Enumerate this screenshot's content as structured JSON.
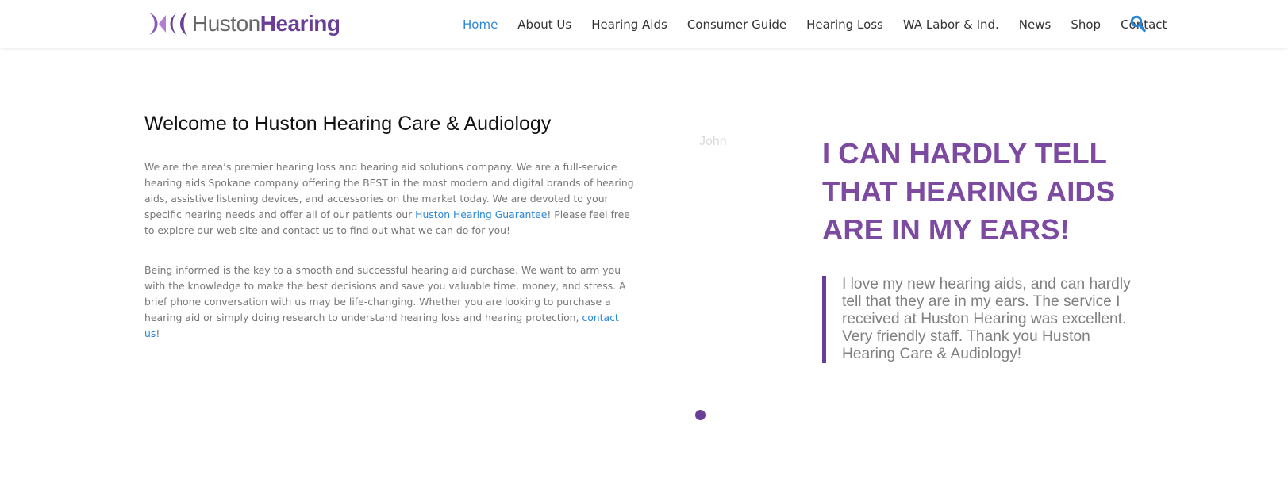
{
  "site": {
    "logo_light": "Huston",
    "logo_bold": "Hearing",
    "brand_color": "#6a3d96",
    "accent_color": "#2a87d8"
  },
  "nav": {
    "items": [
      {
        "label": "Home",
        "active": true
      },
      {
        "label": "About Us"
      },
      {
        "label": "Hearing Aids"
      },
      {
        "label": "Consumer Guide"
      },
      {
        "label": "Hearing Loss"
      },
      {
        "label": "WA Labor & Ind."
      },
      {
        "label": "News"
      },
      {
        "label": "Shop"
      },
      {
        "label": "Contact"
      }
    ],
    "search_icon": "search-icon"
  },
  "main": {
    "title": "Welcome to Huston Hearing Care & Audiology",
    "para1_before": "We are the area’s premier hearing loss and hearing aid solutions company.  We are a full-service hearing aids Spokane company offering the BEST in the most modern and digital brands of hearing aids, assistive listening devices, and accessories on the market today. We are devoted to your specific hearing needs and offer all of our patients our ",
    "para1_link": "Huston Hearing Guarantee",
    "para1_after": "! Please feel free to explore our web site and contact us to find out what we can do for you!",
    "para2_before": "Being informed is the key to a smooth and successful hearing aid purchase. We want to arm you with the knowledge to make the best decisions and save you valuable time, money, and stress. A brief phone conversation with us may be life-changing. Whether you are looking to purchase a hearing aid or simply doing research to understand hearing loss and hearing protection, ",
    "para2_link": "contact us",
    "para2_after": "!"
  },
  "testimonial": {
    "name": "John",
    "title": "I CAN HARDLY TELL THAT HEARING AIDS ARE IN MY EARS!",
    "quote": "I love my new hearing aids, and can hardly tell that they are in my ears.  The service I received at Huston Hearing was excellent.  Very friendly staff.  Thank you Huston Hearing Care & Audiology!"
  }
}
